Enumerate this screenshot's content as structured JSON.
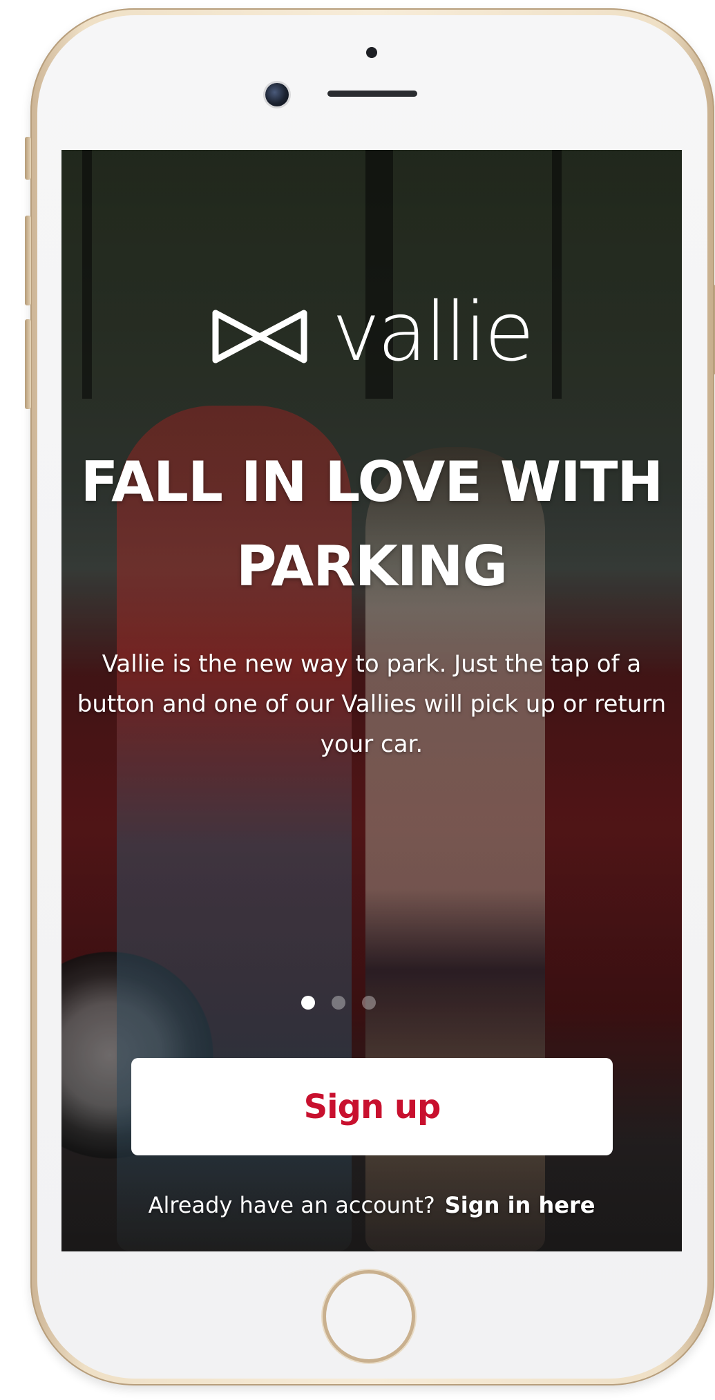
{
  "app": {
    "brand": "vallie"
  },
  "onboarding": {
    "headline": "FALL IN LOVE WITH PARKING",
    "description": "Vallie is the new way to park. Just the tap of a button and one of our Vallies will pick up or return your car.",
    "pages_total": 3,
    "active_page": 1
  },
  "actions": {
    "signup_label": "Sign up",
    "signin_prompt": "Already have an account?",
    "signin_label": "Sign in here"
  },
  "colors": {
    "accent": "#c8102e",
    "button_bg": "#ffffff",
    "text": "#ffffff"
  },
  "icons": {
    "logo_mark": "bowtie-icon"
  }
}
